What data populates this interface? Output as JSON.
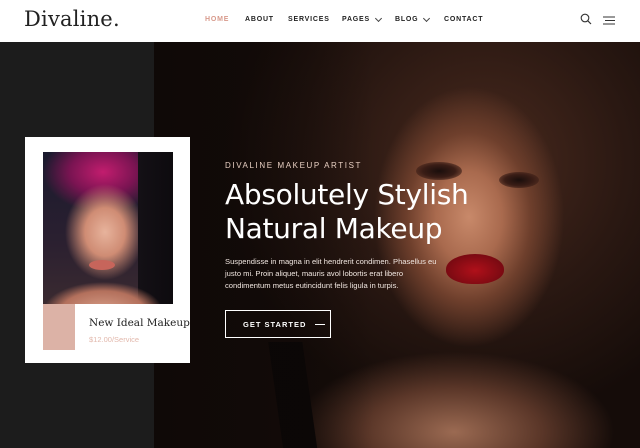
{
  "brand": {
    "logo": "Divaline",
    "logo_dot": "."
  },
  "nav": {
    "items": [
      {
        "label": "HOME",
        "active": true,
        "dropdown": false
      },
      {
        "label": "ABOUT",
        "active": false,
        "dropdown": false
      },
      {
        "label": "SERVICES",
        "active": false,
        "dropdown": false
      },
      {
        "label": "PAGES",
        "active": false,
        "dropdown": true
      },
      {
        "label": "BLOG",
        "active": false,
        "dropdown": true
      },
      {
        "label": "CONTACT",
        "active": false,
        "dropdown": false
      }
    ]
  },
  "header_icons": {
    "search": "search-icon",
    "menu": "hamburger-menu-icon"
  },
  "hero": {
    "eyebrow": "DIVALINE MAKEUP ARTIST",
    "title_line1": "Absolutely Stylish",
    "title_line2": "Natural Makeup",
    "description": "Suspendisse in magna in elit hendrerit condimen. Phasellus eu justo mi. Proin aliquet, mauris avol lobortis erat libero condimentum metus eutincidunt felis ligula in turpis.",
    "button_label": "GET STARTED"
  },
  "card": {
    "title": "New Ideal Makeup",
    "price": "$12.00/Service"
  },
  "colors": {
    "accent": "#d89a8c",
    "price": "#e2b8ac",
    "dark": "#1c1c1c",
    "text": "#222222"
  }
}
